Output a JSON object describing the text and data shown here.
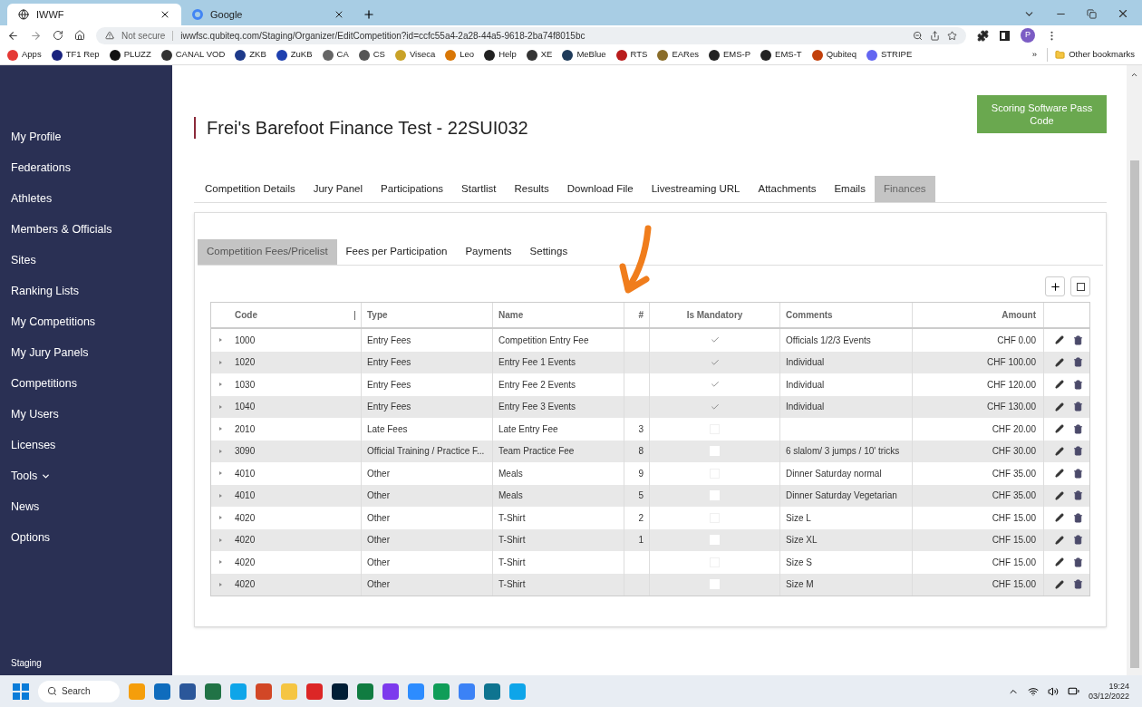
{
  "browser": {
    "tabs": [
      {
        "title": "IWWF",
        "selected": true
      },
      {
        "title": "Google",
        "selected": false
      }
    ],
    "address": {
      "security": "Not secure",
      "url": "iwwfsc.qubiteq.com/Staging/Organizer/EditCompetition?id=ccfc55a4-2a28-44a5-9618-2ba74f8015bc"
    },
    "profile": "P",
    "bookmarks": [
      "Apps",
      "TF1 Rep",
      "PLUZZ",
      "CANAL VOD",
      "ZKB",
      "ZuKB",
      "CA",
      "CS",
      "Viseca",
      "Leo",
      "Help",
      "XE",
      "MeBlue",
      "RTS",
      "EARes",
      "EMS-P",
      "EMS-T",
      "Qubiteq",
      "STRIPE"
    ],
    "more_bookmarks": "»",
    "other_bookmarks": "Other bookmarks"
  },
  "sidebar": {
    "items": [
      {
        "label": "My Profile",
        "dropdown": false
      },
      {
        "label": "Federations",
        "dropdown": false
      },
      {
        "label": "Athletes",
        "dropdown": false
      },
      {
        "label": "Members & Officials",
        "dropdown": false
      },
      {
        "label": "Sites",
        "dropdown": false
      },
      {
        "label": "Ranking Lists",
        "dropdown": false
      },
      {
        "label": "My Competitions",
        "dropdown": false
      },
      {
        "label": "My Jury Panels",
        "dropdown": false
      },
      {
        "label": "Competitions",
        "dropdown": false
      },
      {
        "label": "My Users",
        "dropdown": false
      },
      {
        "label": "Licenses",
        "dropdown": false
      },
      {
        "label": "Tools",
        "dropdown": true
      },
      {
        "label": "News",
        "dropdown": false
      },
      {
        "label": "Options",
        "dropdown": false
      }
    ],
    "footer": "Staging"
  },
  "page": {
    "title": "Frei's Barefoot Finance Test - 22SUI032",
    "pass_code_button": "Scoring Software Pass Code",
    "tabs": [
      {
        "label": "Competition Details",
        "selected": false
      },
      {
        "label": "Jury Panel",
        "selected": false
      },
      {
        "label": "Participations",
        "selected": false
      },
      {
        "label": "Startlist",
        "selected": false
      },
      {
        "label": "Results",
        "selected": false
      },
      {
        "label": "Download File",
        "selected": false
      },
      {
        "label": "Livestreaming URL",
        "selected": false
      },
      {
        "label": "Attachments",
        "selected": false
      },
      {
        "label": "Emails",
        "selected": false
      },
      {
        "label": "Finances",
        "selected": true
      }
    ],
    "subtabs": [
      {
        "label": "Competition Fees/Pricelist",
        "selected": true
      },
      {
        "label": "Fees per Participation",
        "selected": false
      },
      {
        "label": "Payments",
        "selected": false
      },
      {
        "label": "Settings",
        "selected": false
      }
    ]
  },
  "table": {
    "columns": [
      {
        "label": "Code",
        "sorted": true
      },
      {
        "label": "Type",
        "sorted": false
      },
      {
        "label": "Name",
        "sorted": false
      },
      {
        "label": "#",
        "sorted": false
      },
      {
        "label": "Is Mandatory",
        "sorted": false
      },
      {
        "label": "Comments",
        "sorted": false
      },
      {
        "label": "Amount",
        "sorted": false
      }
    ],
    "rows": [
      {
        "code": "1000",
        "type": "Entry Fees",
        "name": "Competition Entry Fee",
        "count": "",
        "mandatory": true,
        "comments": "Officials 1/2/3 Events",
        "amount": "CHF 0.00"
      },
      {
        "code": "1020",
        "type": "Entry Fees",
        "name": "Entry Fee 1 Events",
        "count": "",
        "mandatory": true,
        "comments": "Individual",
        "amount": "CHF 100.00"
      },
      {
        "code": "1030",
        "type": "Entry Fees",
        "name": "Entry Fee 2 Events",
        "count": "",
        "mandatory": true,
        "comments": "Individual",
        "amount": "CHF 120.00"
      },
      {
        "code": "1040",
        "type": "Entry Fees",
        "name": "Entry Fee 3 Events",
        "count": "",
        "mandatory": true,
        "comments": "Individual",
        "amount": "CHF 130.00"
      },
      {
        "code": "2010",
        "type": "Late Fees",
        "name": "Late Entry Fee",
        "count": "3",
        "mandatory": false,
        "comments": "",
        "amount": "CHF 20.00"
      },
      {
        "code": "3090",
        "type": "Official Training / Practice F...",
        "name": "Team Practice Fee",
        "count": "8",
        "mandatory": false,
        "comments": "6 slalom/ 3 jumps / 10' tricks",
        "amount": "CHF 30.00"
      },
      {
        "code": "4010",
        "type": "Other",
        "name": "Meals",
        "count": "9",
        "mandatory": false,
        "comments": "Dinner Saturday normal",
        "amount": "CHF 35.00"
      },
      {
        "code": "4010",
        "type": "Other",
        "name": "Meals",
        "count": "5",
        "mandatory": false,
        "comments": "Dinner Saturday Vegetarian",
        "amount": "CHF 35.00"
      },
      {
        "code": "4020",
        "type": "Other",
        "name": "T-Shirt",
        "count": "2",
        "mandatory": false,
        "comments": "Size L",
        "amount": "CHF 15.00"
      },
      {
        "code": "4020",
        "type": "Other",
        "name": "T-Shirt",
        "count": "1",
        "mandatory": false,
        "comments": "Size XL",
        "amount": "CHF 15.00"
      },
      {
        "code": "4020",
        "type": "Other",
        "name": "T-Shirt",
        "count": "",
        "mandatory": false,
        "comments": "Size S",
        "amount": "CHF 15.00"
      },
      {
        "code": "4020",
        "type": "Other",
        "name": "T-Shirt",
        "count": "",
        "mandatory": false,
        "comments": "Size M",
        "amount": "CHF 15.00"
      }
    ]
  },
  "taskbar": {
    "search": "Search",
    "time": "19:24",
    "date": "03/12/2022"
  }
}
